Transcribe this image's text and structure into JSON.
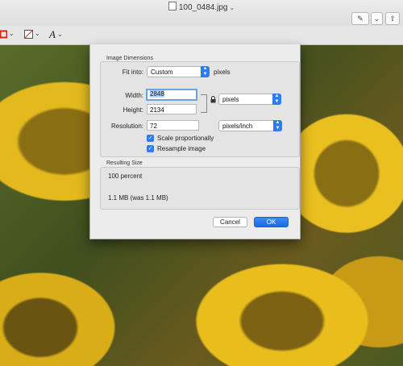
{
  "window": {
    "title": "100_0484.jpg"
  },
  "toolbar": {
    "pen_button_label": "✎",
    "share_button_label": "⇧"
  },
  "dialog": {
    "dimensions_title": "Image Dimensions",
    "fit_into": {
      "label": "Fit into:",
      "value": "Custom",
      "unit": "pixels"
    },
    "width": {
      "label": "Width:",
      "value": "2848"
    },
    "height": {
      "label": "Height:",
      "value": "2134"
    },
    "size_unit": "pixels",
    "resolution": {
      "label": "Resolution:",
      "value": "72",
      "unit": "pixels/inch"
    },
    "scale_proportionally": {
      "label": "Scale proportionally",
      "checked": true
    },
    "resample_image": {
      "label": "Resample image",
      "checked": true
    },
    "result_title": "Resulting Size",
    "result_percent": "100 percent",
    "result_size": "1.1 MB (was 1.1 MB)",
    "cancel_label": "Cancel",
    "ok_label": "OK"
  },
  "colors": {
    "accent": "#2f7cf0",
    "dialog_bg": "#ececec"
  }
}
